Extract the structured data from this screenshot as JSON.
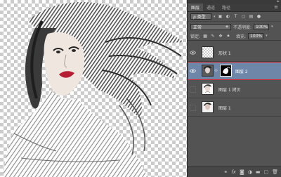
{
  "tabs": [
    {
      "label": "图层",
      "active": true
    },
    {
      "label": "通道",
      "active": false
    },
    {
      "label": "路径",
      "active": false
    }
  ],
  "filter": {
    "kind_label": "ρ 类型"
  },
  "blend": {
    "mode": "正常",
    "opacity_label": "不透明度:",
    "opacity_value": "100%"
  },
  "lock": {
    "label": "锁定:",
    "fill_label": "填充:",
    "fill_value": "100%"
  },
  "layers": [
    {
      "name": "形状 1",
      "visible": true,
      "selected": false
    },
    {
      "name": "图层 2",
      "visible": true,
      "selected": true
    },
    {
      "name": "图层 1 拷贝",
      "visible": false,
      "selected": false
    },
    {
      "name": "图层 1",
      "visible": false,
      "selected": false
    }
  ],
  "colors": {
    "selection": "#6e86a7",
    "highlight_border": "#d12424",
    "panel_bg": "#535353"
  },
  "footer_icons": [
    "link-icon",
    "fx-icon",
    "mask-icon",
    "adjustment-icon",
    "group-icon",
    "new-layer-icon",
    "trash-icon"
  ]
}
